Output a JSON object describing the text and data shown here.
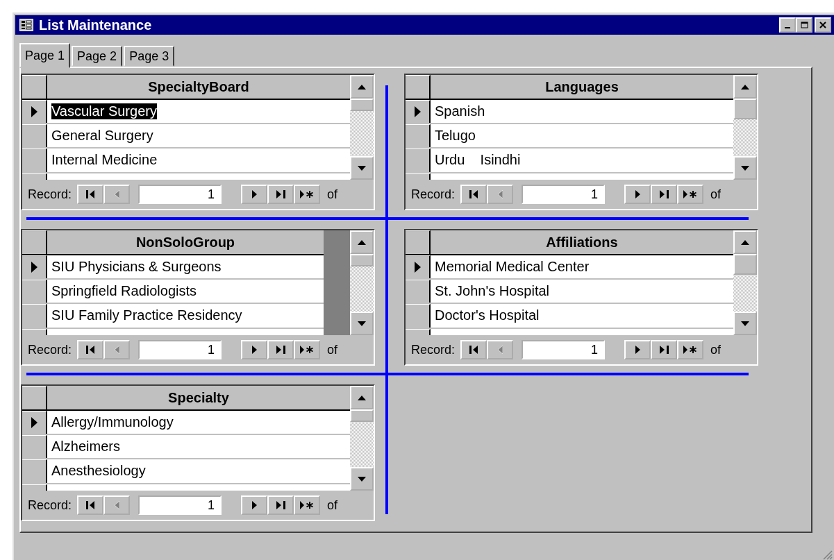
{
  "window": {
    "title": "List Maintenance"
  },
  "tabs": [
    {
      "label": "Page 1",
      "selected": true
    },
    {
      "label": "Page 2",
      "selected": false
    },
    {
      "label": "Page 3",
      "selected": false
    }
  ],
  "subforms": [
    {
      "heading": "SpecialtyBoard",
      "column_fills_width": true,
      "rows": [
        {
          "text": "Vascular Surgery",
          "current": true,
          "highlighted": true
        },
        {
          "text": "General Surgery",
          "current": false,
          "highlighted": false
        },
        {
          "text": "Internal Medicine",
          "current": false,
          "highlighted": false
        }
      ],
      "nav": {
        "label": "Record:",
        "suffix": "of",
        "items": [
          {
            "kind": "first",
            "disabled": false
          },
          {
            "kind": "prev",
            "disabled": true
          },
          {
            "kind": "field",
            "value": "1"
          },
          {
            "kind": "next",
            "disabled": false
          },
          {
            "kind": "last",
            "disabled": false
          },
          {
            "kind": "new",
            "disabled": false
          }
        ]
      }
    },
    {
      "heading": "Languages",
      "column_fills_width": true,
      "rows": [
        {
          "text": "Spanish",
          "current": true,
          "highlighted": false
        },
        {
          "text": "Telugo",
          "current": false,
          "highlighted": false
        },
        {
          "text": "Urdu    Isindhi",
          "current": false,
          "highlighted": false
        }
      ],
      "nav": {
        "label": "Record:",
        "suffix": "of",
        "items": [
          {
            "kind": "first",
            "disabled": false
          },
          {
            "kind": "prev",
            "disabled": true
          },
          {
            "kind": "field",
            "value": "1"
          },
          {
            "kind": "next",
            "disabled": false
          },
          {
            "kind": "last",
            "disabled": false
          },
          {
            "kind": "new",
            "disabled": false
          }
        ]
      }
    },
    {
      "heading": "NonSoloGroup",
      "column_fills_width": false,
      "rows": [
        {
          "text": "SIU Physicians & Surgeons",
          "current": true,
          "highlighted": false
        },
        {
          "text": "Springfield Radiologists",
          "current": false,
          "highlighted": false
        },
        {
          "text": "SIU Family Practice Residency",
          "current": false,
          "highlighted": false
        }
      ],
      "nav": {
        "label": "Record:",
        "suffix": "of",
        "items": [
          {
            "kind": "first",
            "disabled": false
          },
          {
            "kind": "prev",
            "disabled": true
          },
          {
            "kind": "field",
            "value": "1"
          },
          {
            "kind": "next",
            "disabled": false
          },
          {
            "kind": "last",
            "disabled": false
          },
          {
            "kind": "new",
            "disabled": false
          }
        ]
      }
    },
    {
      "heading": "Affiliations",
      "column_fills_width": true,
      "rows": [
        {
          "text": "Memorial Medical Center",
          "current": true,
          "highlighted": false
        },
        {
          "text": "St. John's Hospital",
          "current": false,
          "highlighted": false
        },
        {
          "text": "Doctor's Hospital",
          "current": false,
          "highlighted": false
        }
      ],
      "nav": {
        "label": "Record:",
        "suffix": "of",
        "items": [
          {
            "kind": "first",
            "disabled": false
          },
          {
            "kind": "prev",
            "disabled": true
          },
          {
            "kind": "field",
            "value": "1"
          },
          {
            "kind": "next",
            "disabled": false
          },
          {
            "kind": "last",
            "disabled": false
          },
          {
            "kind": "new",
            "disabled": false
          }
        ]
      }
    },
    {
      "heading": "Specialty",
      "column_fills_width": true,
      "rows": [
        {
          "text": "Allergy/Immunology",
          "current": true,
          "highlighted": false
        },
        {
          "text": "Alzheimers",
          "current": false,
          "highlighted": false
        },
        {
          "text": "Anesthesiology",
          "current": false,
          "highlighted": false
        }
      ],
      "nav": {
        "label": "Record:",
        "suffix": "of",
        "items": [
          {
            "kind": "first",
            "disabled": false
          },
          {
            "kind": "prev",
            "disabled": true
          },
          {
            "kind": "field",
            "value": "1"
          },
          {
            "kind": "next",
            "disabled": false
          },
          {
            "kind": "last",
            "disabled": false
          },
          {
            "kind": "new",
            "disabled": false
          }
        ]
      }
    }
  ]
}
